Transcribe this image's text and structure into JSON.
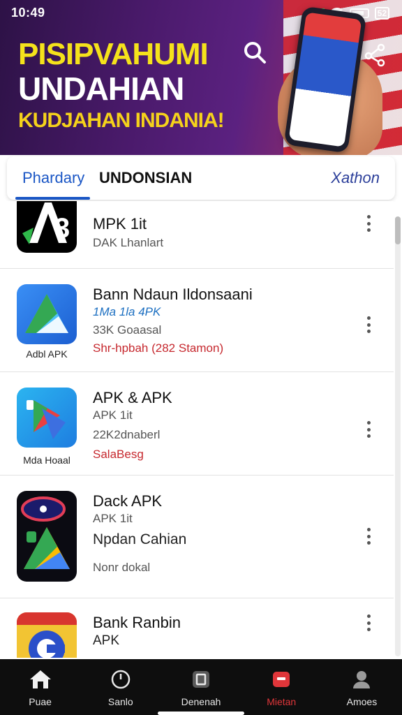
{
  "status_bar": {
    "time": "10:49",
    "battery_pct": "52"
  },
  "banner": {
    "line1": "PISIPVAHUMI",
    "line2": "UNDAHIAN",
    "line3": "KUDJAHAN INDANIA!",
    "icons": {
      "search": "search-icon",
      "share": "share-icon"
    }
  },
  "tabs": [
    {
      "label": "Phardary",
      "active": true
    },
    {
      "label": "UNDONSIAN",
      "active": false
    },
    {
      "label": "Xathon",
      "active": false
    }
  ],
  "apps": [
    {
      "title": "MPK 1it",
      "lines": [
        "DAK Lhanlart"
      ],
      "caption": ""
    },
    {
      "title": "Bann Ndaun Ildonsaani",
      "lines": [
        "1Ma 1la 4PK",
        "33K Goaasal",
        "Shr-hpbah (282 Stamon)"
      ],
      "caption": "Adbl APK"
    },
    {
      "title": "APK  & APK",
      "lines": [
        "APK 1it",
        "22K2dnaberl",
        "SalaBesg"
      ],
      "caption": "Mda Hoaal"
    },
    {
      "title": "Dack APK",
      "lines": [
        "APK 1it",
        "Npdan Cahian",
        "Nonr dokal"
      ],
      "caption": ""
    },
    {
      "title": "Bank Ranbin",
      "lines": [
        "APK"
      ],
      "caption": ""
    }
  ],
  "bottom_nav": [
    {
      "label": "Puae",
      "icon": "home-icon",
      "active": false
    },
    {
      "label": "Sanlo",
      "icon": "clock-icon",
      "active": false
    },
    {
      "label": "Denenah",
      "icon": "apps-icon",
      "active": false
    },
    {
      "label": "Mietan",
      "icon": "store-icon",
      "active": true
    },
    {
      "label": "Amoes",
      "icon": "profile-icon",
      "active": false
    }
  ],
  "colors": {
    "accent": "#1a56c5",
    "active_nav": "#e0363a",
    "headline_yellow": "#f5e21b"
  }
}
